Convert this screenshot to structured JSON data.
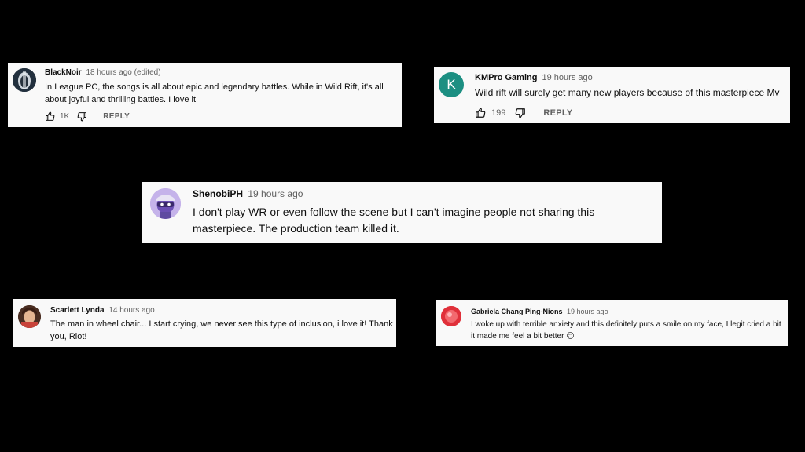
{
  "comments": [
    {
      "author": "BlackNoir",
      "time": "18 hours ago (edited)",
      "text": "In League PC, the songs is all about epic and legendary battles. While in Wild Rift, it's all about joyful and thrilling battles. I love it",
      "likes": "1K",
      "reply_label": "REPLY"
    },
    {
      "author": "KMPro Gaming",
      "time": "19 hours ago",
      "text": "Wild rift will surely get many new players because of this masterpiece Mv",
      "likes": "199",
      "reply_label": "REPLY",
      "avatar_letter": "K",
      "avatar_color": "#1c8f82"
    },
    {
      "author": "ShenobiPH",
      "time": "19 hours ago",
      "text": "I don't play WR or even follow the scene but I can't imagine people not sharing this masterpiece. The production team killed it."
    },
    {
      "author": "Scarlett Lynda",
      "time": "14 hours ago",
      "text": "The man in wheel chair... I start crying, we never see this type of inclusion, i love it! Thank you, Riot!"
    },
    {
      "author": "Gabriela Chang Ping-Nions",
      "time": "19 hours ago",
      "text": "I woke up with terrible anxiety and this definitely puts a smile on my face, I legit cried a bit it made me feel a bit better",
      "emoji": "😊"
    }
  ],
  "icons": {
    "like": "thumbs-up-icon",
    "dislike": "thumbs-down-icon"
  }
}
